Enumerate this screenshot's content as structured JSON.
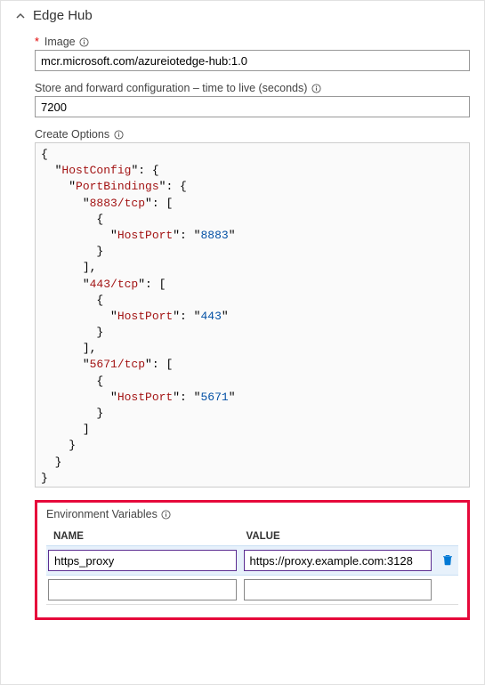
{
  "header": {
    "title": "Edge Hub"
  },
  "image": {
    "label": "Image",
    "value": "mcr.microsoft.com/azureiotedge-hub:1.0"
  },
  "ttl": {
    "label": "Store and forward configuration – time to live (seconds)",
    "value": "7200"
  },
  "createOptions": {
    "label": "Create Options",
    "keys": {
      "hostConfig": "HostConfig",
      "portBindings": "PortBindings",
      "p8883": "8883/tcp",
      "p443": "443/tcp",
      "p5671": "5671/tcp",
      "hostPort": "HostPort"
    },
    "values": {
      "v8883": "8883",
      "v443": "443",
      "v5671": "5671"
    }
  },
  "env": {
    "label": "Environment Variables",
    "headers": {
      "name": "NAME",
      "value": "VALUE"
    },
    "rows": [
      {
        "name": "https_proxy",
        "value": "https://proxy.example.com:3128"
      },
      {
        "name": "",
        "value": ""
      }
    ]
  }
}
